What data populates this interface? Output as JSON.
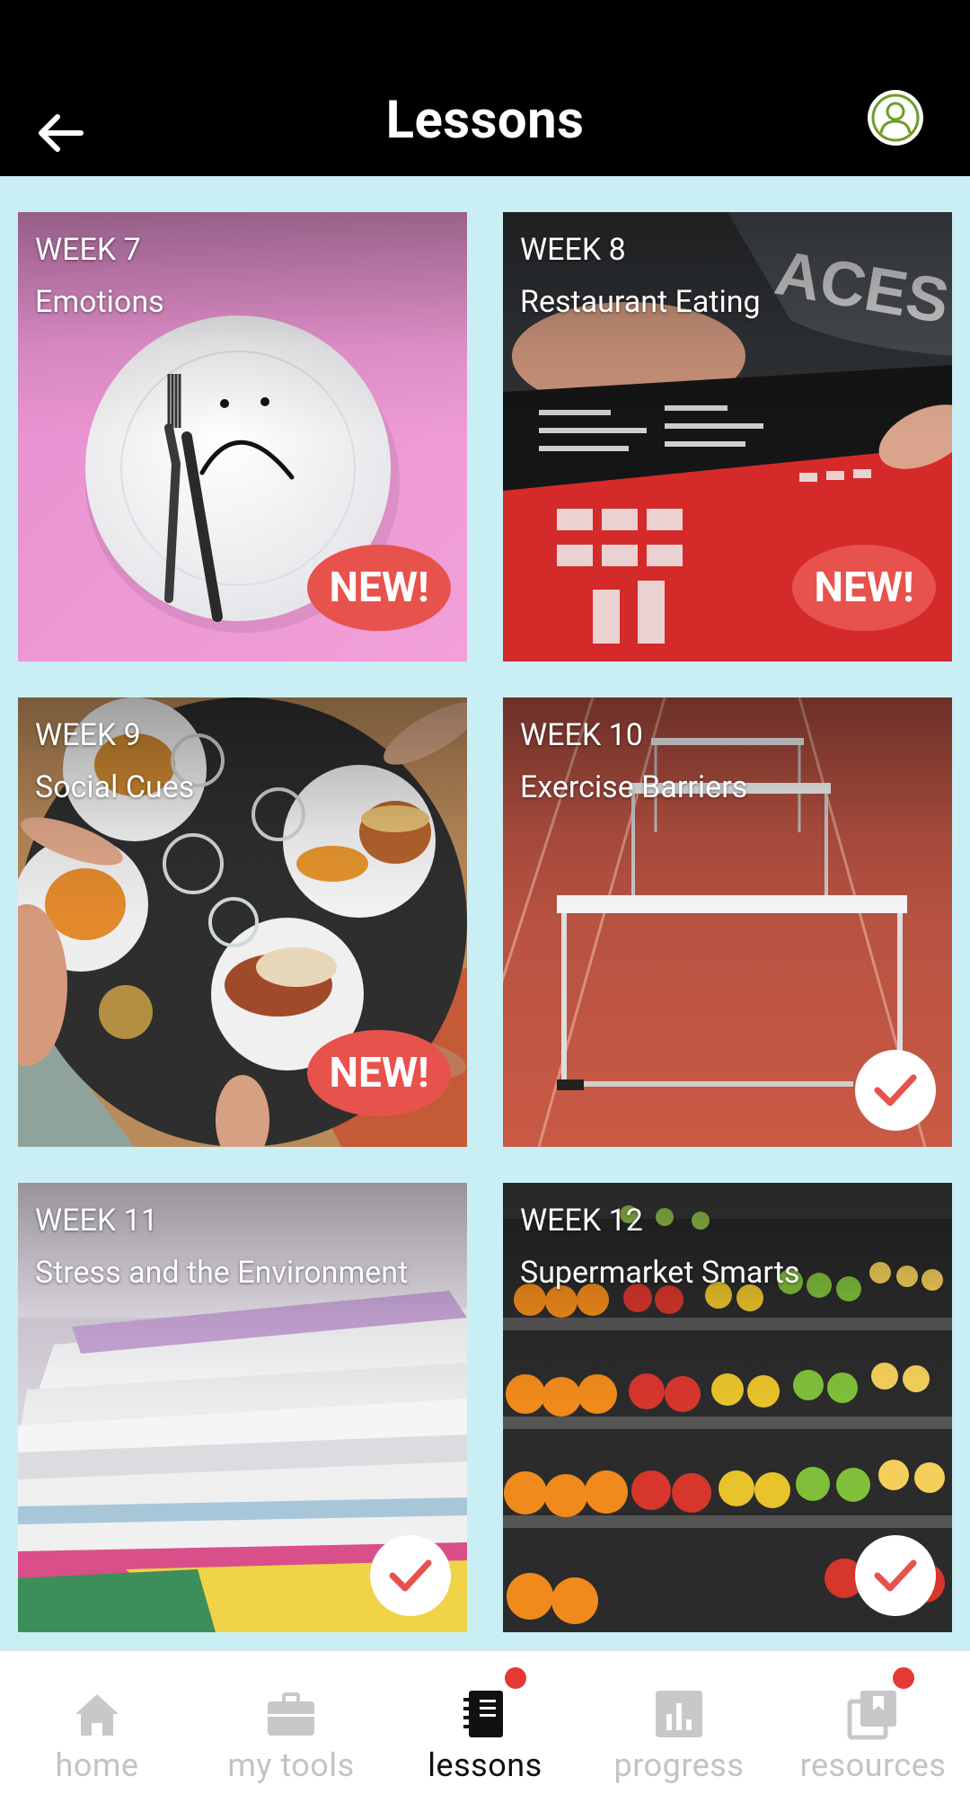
{
  "header": {
    "title": "Lessons",
    "back_icon": "arrow-left-icon",
    "profile_icon": "user-avatar-icon"
  },
  "lessons": [
    {
      "week": "WEEK 7",
      "title": "Emotions",
      "status": "new",
      "badge_text": "NEW!"
    },
    {
      "week": "WEEK 8",
      "title": "Restaurant Eating",
      "status": "new",
      "badge_text": "NEW!"
    },
    {
      "week": "WEEK 9",
      "title": "Social Cues",
      "status": "new",
      "badge_text": "NEW!"
    },
    {
      "week": "WEEK 10",
      "title": "Exercise Barriers",
      "status": "completed"
    },
    {
      "week": "WEEK 11",
      "title": "Stress and the Environment",
      "status": "completed"
    },
    {
      "week": "WEEK 12",
      "title": "Supermarket Smarts",
      "status": "completed"
    }
  ],
  "nav": {
    "items": [
      {
        "label": "home",
        "icon": "home-icon",
        "active": false
      },
      {
        "label": "my tools",
        "icon": "briefcase-icon",
        "active": false
      },
      {
        "label": "lessons",
        "icon": "notebook-icon",
        "active": true,
        "notification": true
      },
      {
        "label": "progress",
        "icon": "bar-chart-icon",
        "active": false
      },
      {
        "label": "resources",
        "icon": "book-icon",
        "active": false,
        "notification": true
      }
    ]
  },
  "colors": {
    "background": "#c9eff4",
    "header": "#000000",
    "new_badge": "#e8524c",
    "check_mark": "#e8524c",
    "notification_dot": "#e53935",
    "nav_inactive": "#c3c3c3",
    "nav_active": "#111111"
  }
}
